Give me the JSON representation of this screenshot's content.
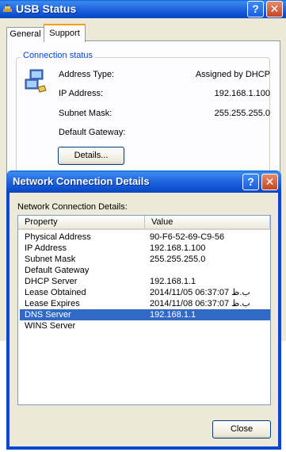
{
  "usb_window": {
    "title": "USB Status",
    "tabs": [
      {
        "label": "General"
      },
      {
        "label": "Support"
      }
    ],
    "connection_status": {
      "caption": "Connection status",
      "rows": [
        {
          "label": "Address Type:",
          "value": "Assigned by DHCP"
        },
        {
          "label": "IP Address:",
          "value": "192.168.1.100"
        },
        {
          "label": "Subnet Mask:",
          "value": "255.255.255.0"
        },
        {
          "label": "Default Gateway:",
          "value": ""
        }
      ],
      "details_label": "Details..."
    },
    "help_glyph": "?",
    "close_glyph": "✕"
  },
  "dialog": {
    "title": "Network Connection Details",
    "caption": "Network Connection Details:",
    "columns": [
      "Property",
      "Value"
    ],
    "rows": [
      {
        "property": "Physical Address",
        "value": "90-F6-52-69-C9-56"
      },
      {
        "property": "IP Address",
        "value": "192.168.1.100"
      },
      {
        "property": "Subnet Mask",
        "value": "255.255.255.0"
      },
      {
        "property": "Default Gateway",
        "value": ""
      },
      {
        "property": "DHCP Server",
        "value": "192.168.1.1"
      },
      {
        "property": "Lease Obtained",
        "value": "2014/11/05 06:37:07 ب.ظ"
      },
      {
        "property": "Lease Expires",
        "value": "2014/11/08 06:37:07 ب.ظ"
      },
      {
        "property": "DNS Server",
        "value": "192.168.1.1"
      },
      {
        "property": "WINS Server",
        "value": ""
      }
    ],
    "selected_row": 7,
    "close_label": "Close",
    "help_glyph": "?",
    "close_glyph": "✕"
  },
  "colors": {
    "titlebar": "#0a46d2",
    "selection": "#316ac5",
    "group_caption": "#0046d5",
    "active_tab_accent": "#f0a000"
  }
}
